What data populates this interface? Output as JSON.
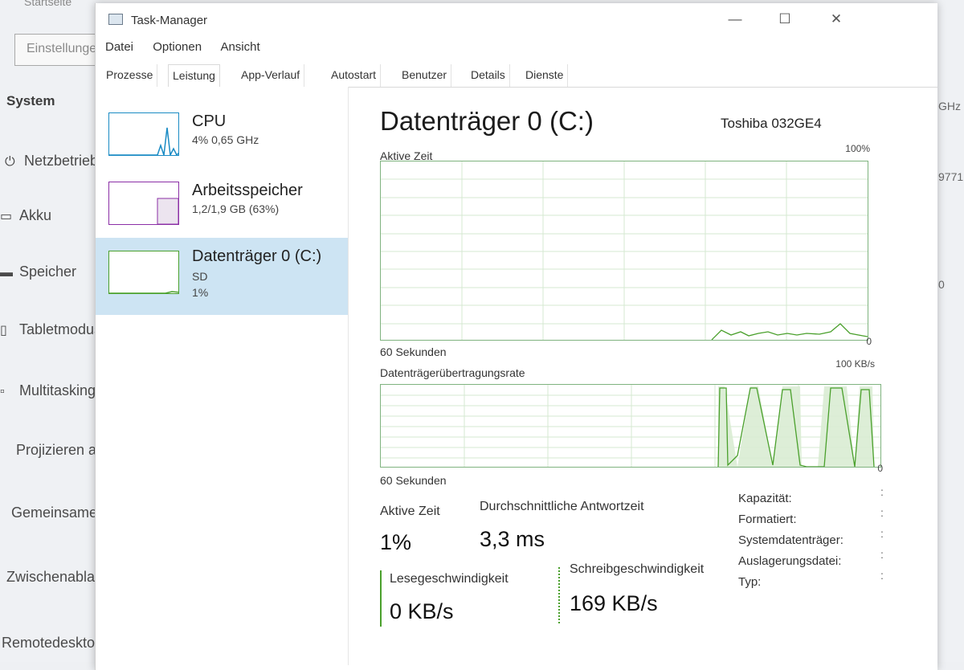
{
  "background": {
    "top_text": "Startseite",
    "search_text": "Einstellungen suchen",
    "section": "System",
    "nav": [
      {
        "label": "Netzbetrieb und Energie",
        "icon": "power-icon"
      },
      {
        "label": "Akku",
        "icon": "battery-icon"
      },
      {
        "label": "Speicher",
        "icon": "storage-icon"
      },
      {
        "label": "Tabletmodus",
        "icon": "tablet-icon"
      },
      {
        "label": "Multitasking",
        "icon": "multitask-icon"
      },
      {
        "label": "Projizieren auf diesen PC",
        "icon": ""
      },
      {
        "label": "Gemeinsame Nutzung",
        "icon": ""
      },
      {
        "label": "Zwischenablage",
        "icon": ""
      },
      {
        "label": "Remotedesktop",
        "icon": ""
      }
    ],
    "right_texts": [
      "GHz",
      "9771",
      "0"
    ]
  },
  "window": {
    "title": "Task-Manager",
    "controls": {
      "minimize": "—",
      "maximize": "☐",
      "close": "✕"
    }
  },
  "menu": [
    "Datei",
    "Optionen",
    "Ansicht"
  ],
  "tabs": [
    "Prozesse",
    "Leistung",
    "App-Verlauf",
    "Autostart",
    "Benutzer",
    "Details",
    "Dienste"
  ],
  "active_tab": "Leistung",
  "resources": [
    {
      "name": "CPU",
      "line1": "4% 0,65 GHz",
      "line2": "",
      "color": "#1a8bc4",
      "selected": false
    },
    {
      "name": "Arbeitsspeicher",
      "line1": "1,2/1,9 GB (63%)",
      "line2": "",
      "color": "#8b2fa6",
      "selected": false
    },
    {
      "name": "Datenträger 0 (C:)",
      "line1": "SD",
      "line2": "1%",
      "color": "#4aa02c",
      "selected": true
    }
  ],
  "detail": {
    "title": "Datenträger 0 (C:)",
    "model": "Toshiba 032GE4",
    "graph1": {
      "label": "Aktive Zeit",
      "max": "100%",
      "min": "0",
      "time": "60 Sekunden"
    },
    "graph2": {
      "label": "Datenträgerübertragungsrate",
      "max": "100 KB/s",
      "min": "0",
      "time": "60 Sekunden"
    },
    "active_time_label": "Aktive Zeit",
    "active_time_value": "1%",
    "response_label": "Durchschnittliche Antwortzeit",
    "response_value": "3,3 ms",
    "read_label": "Lesegeschwindigkeit",
    "read_value": "0 KB/s",
    "write_label": "Schreibgeschwindigkeit",
    "write_value": "169 KB/s",
    "properties": [
      "Kapazität:",
      "Formatiert:",
      "Systemdatenträger:",
      "Auslagerungsdatei:",
      "Typ:"
    ],
    "property_values": ":",
    "line_color": "#4aa02c"
  }
}
